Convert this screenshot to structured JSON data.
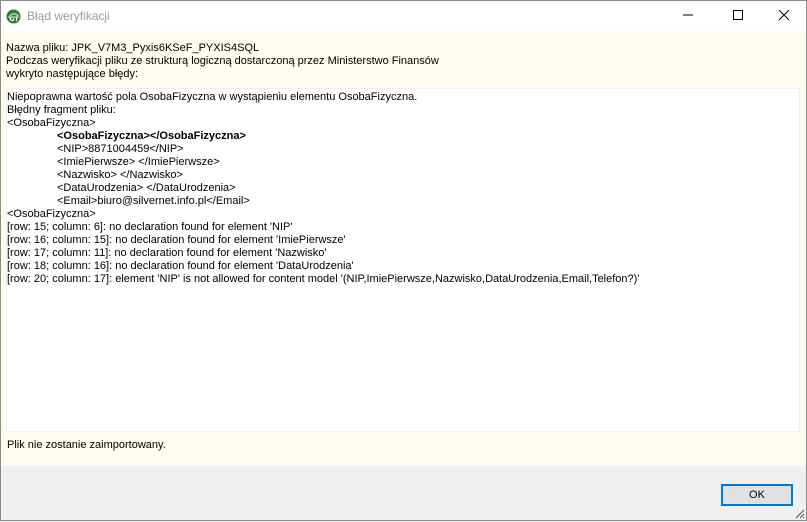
{
  "window": {
    "title": "Błąd weryfikacji",
    "accent_color": "#0078d7"
  },
  "header": {
    "file_line": "Nazwa pliku: JPK_V7M3_Pyxis6KSeF_PYXIS4SQL",
    "verify_line1": "Podczas weryfikacji pliku ze strukturą logiczną dostarczoną przez Ministerstwo Finansów",
    "verify_line2": "wykryto następujące błędy:"
  },
  "error": {
    "message": "Niepoprawna wartość pola OsobaFizyczna w wystąpieniu elementu OsobaFizyczna.",
    "fragment_label": "Błędny fragment pliku:",
    "xml_open": "<OsobaFizyczna>",
    "xml_lines": [
      "<OsobaFizyczna></OsobaFizyczna>",
      "<NIP>8871004459</NIP>",
      "<ImiePierwsze> </ImiePierwsze>",
      "<Nazwisko> </Nazwisko>",
      "<DataUrodzenia> </DataUrodzenia>",
      "<Email>biuro@silvernet.info.pl</Email>"
    ],
    "xml_close": "<OsobaFizyczna>",
    "details": [
      "[row: 15; column: 6]: no declaration found for element 'NIP'",
      "[row: 16; column: 15]: no declaration found for element 'ImiePierwsze'",
      "[row: 17; column: 11]: no declaration found for element 'Nazwisko'",
      "[row: 18; column: 16]: no declaration found for element 'DataUrodzenia'",
      "[row: 20; column: 17]: element 'NIP' is not allowed for content model '(NIP,ImiePierwsze,Nazwisko,DataUrodzenia,Email,Telefon?)'"
    ]
  },
  "footer": {
    "message": "Plik nie zostanie zaimportowany."
  },
  "buttons": {
    "ok_label": "OK"
  },
  "icons": {
    "app": "app-logo-icon",
    "minimize": "minimize-icon",
    "maximize": "maximize-icon",
    "close": "close-icon",
    "grip": "resize-grip-icon"
  }
}
